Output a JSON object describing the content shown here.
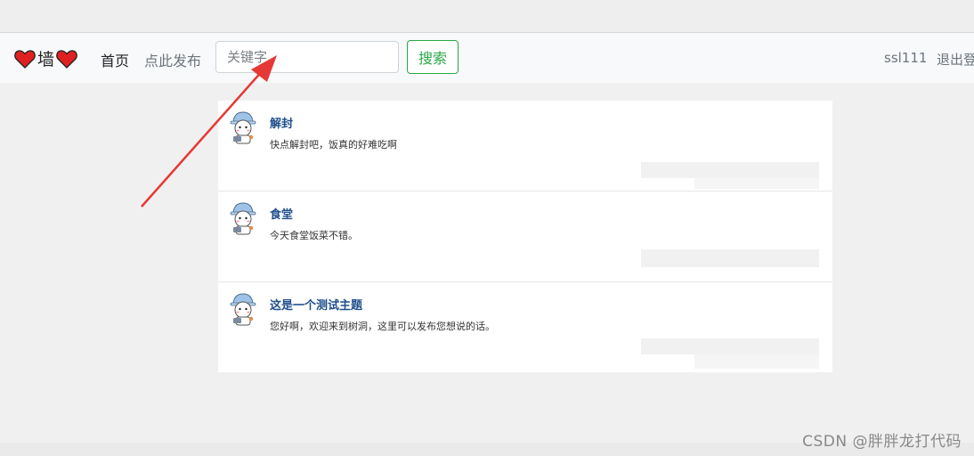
{
  "navbar": {
    "brand": "墙",
    "home": "首页",
    "post": "点此发布",
    "search_placeholder": "关键字",
    "search_button": "搜索",
    "username": "ssl111",
    "logout": "退出登录"
  },
  "posts": [
    {
      "title": "解封",
      "body": "快点解封吧，饭真的好难吃啊"
    },
    {
      "title": "食堂",
      "body": "今天食堂饭菜不错。"
    },
    {
      "title": "这是一个测试主题",
      "body": "您好啊，欢迎来到树洞，这里可以发布您想说的话。"
    }
  ],
  "watermark": "CSDN @胖胖龙打代码",
  "colors": {
    "accent_green": "#28a745",
    "link_blue": "#1f4e8c",
    "arrow_red": "#e53935"
  }
}
